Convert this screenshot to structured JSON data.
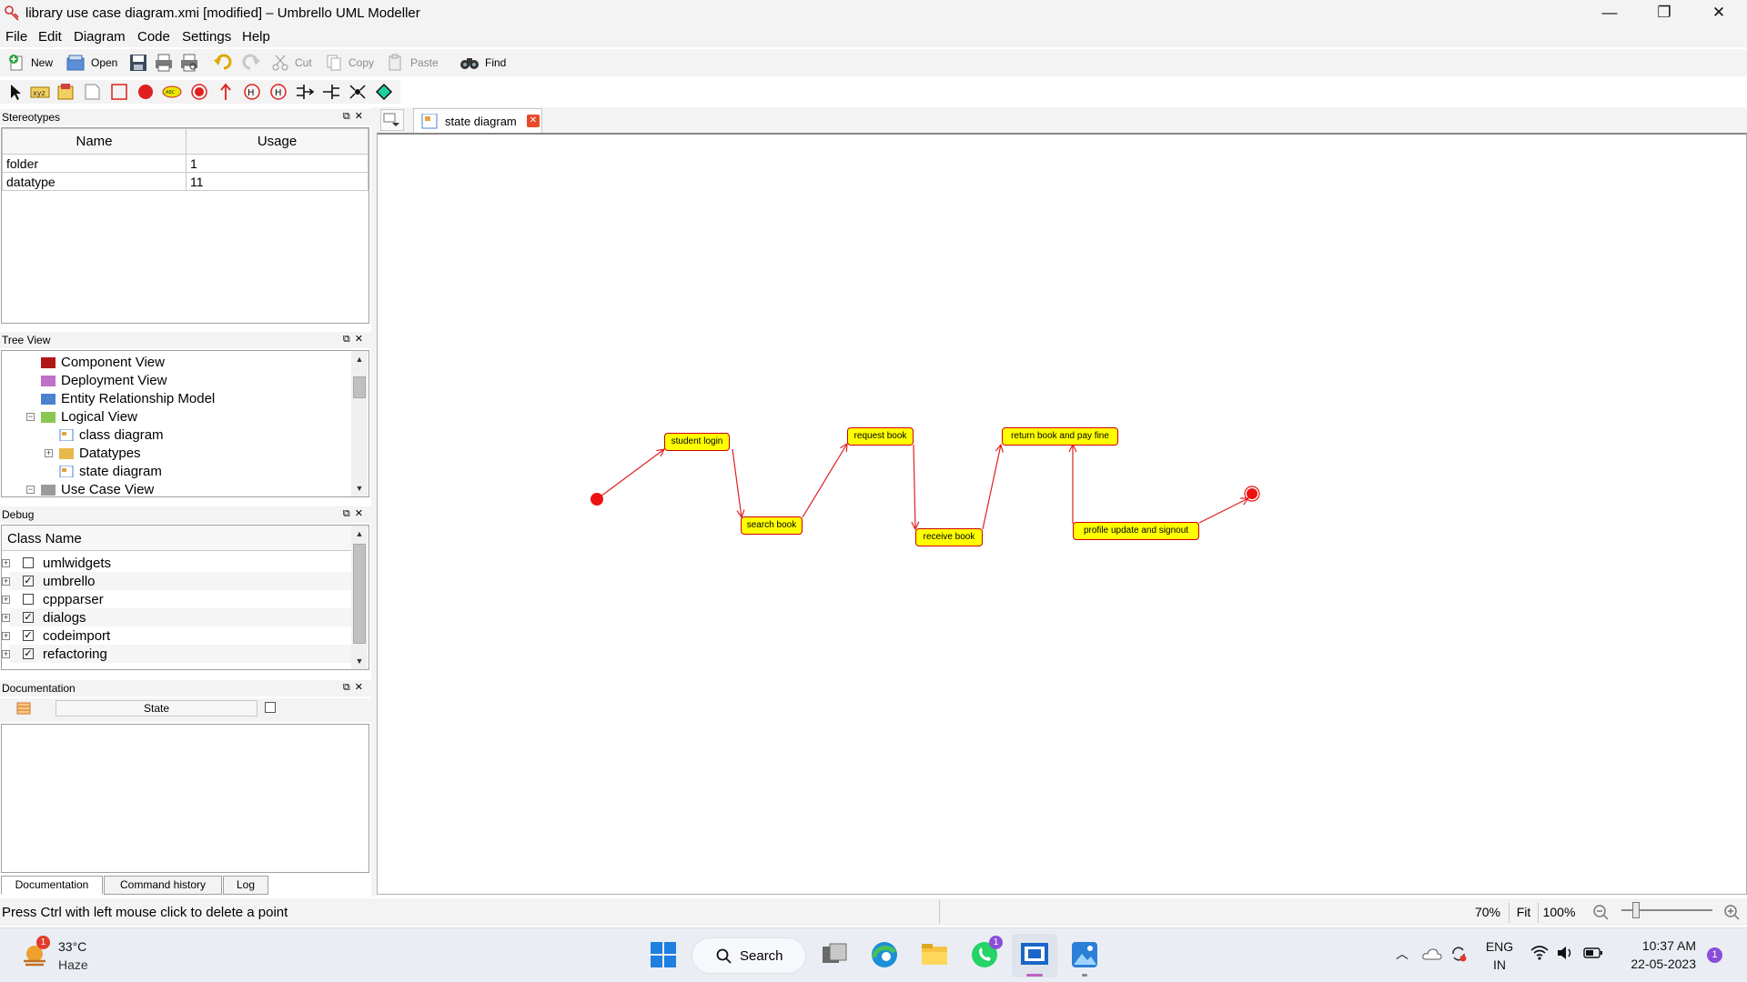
{
  "window": {
    "title": "library use case diagram.xmi [modified] – Umbrello UML Modeller",
    "minimize": "—",
    "restore": "❐",
    "close": "✕"
  },
  "menu": [
    "File",
    "Edit",
    "Diagram",
    "Code",
    "Settings",
    "Help"
  ],
  "toolbar": {
    "new": "New",
    "open": "Open",
    "cut": "Cut",
    "copy": "Copy",
    "paste": "Paste",
    "find": "Find"
  },
  "stereotypes": {
    "title": "Stereotypes",
    "columns": [
      "Name",
      "Usage"
    ],
    "rows": [
      {
        "name": "folder",
        "usage": "1"
      },
      {
        "name": "datatype",
        "usage": "11"
      }
    ]
  },
  "tree_view": {
    "title": "Tree View",
    "items": [
      {
        "label": "Component View",
        "icon": "component-folder-icon",
        "color": "#b01818"
      },
      {
        "label": "Deployment View",
        "icon": "deployment-folder-icon",
        "color": "#c070c8"
      },
      {
        "label": "Entity Relationship Model",
        "icon": "er-folder-icon",
        "color": "#4a82d0"
      },
      {
        "label": "Logical View",
        "icon": "logical-folder-icon",
        "color": "#8ac852"
      },
      {
        "label": "class diagram",
        "icon": "diagram-icon"
      },
      {
        "label": "Datatypes",
        "icon": "folder-icon",
        "color": "#e8b84a"
      },
      {
        "label": "state diagram",
        "icon": "diagram-icon"
      },
      {
        "label": "Use Case View",
        "icon": "usecase-folder-icon",
        "color": "#9a9a9a"
      }
    ]
  },
  "debug": {
    "title": "Debug",
    "column": "Class Name",
    "rows": [
      {
        "name": "umlwidgets",
        "checked": false
      },
      {
        "name": "umbrello",
        "checked": true
      },
      {
        "name": "cppparser",
        "checked": false
      },
      {
        "name": "dialogs",
        "checked": true
      },
      {
        "name": "codeimport",
        "checked": true
      },
      {
        "name": "refactoring",
        "checked": true
      }
    ]
  },
  "documentation": {
    "title": "Documentation",
    "state_label": "State",
    "tabs": [
      "Documentation",
      "Command history",
      "Log"
    ]
  },
  "diagram_tab": {
    "label": "state diagram"
  },
  "diagram": {
    "states": [
      {
        "id": "s1",
        "label": "student login"
      },
      {
        "id": "s2",
        "label": "search book"
      },
      {
        "id": "s3",
        "label": "request book"
      },
      {
        "id": "s4",
        "label": "receive book"
      },
      {
        "id": "s5",
        "label": "return book and pay fine"
      },
      {
        "id": "s6",
        "label": "profile update and signout"
      }
    ],
    "colors": {
      "state_fill": "#ffff00",
      "state_border": "#d00000",
      "transition": "#e02020",
      "pseudo": "#ee1111"
    }
  },
  "status": {
    "message": "Press Ctrl with left mouse click to delete a point",
    "zoom": "70%",
    "fit": "Fit",
    "full": "100%"
  },
  "taskbar": {
    "weather_temp": "33°C",
    "weather_desc": "Haze",
    "weather_badge": "1",
    "search": "Search",
    "whatsapp_badge": "1",
    "lang1": "ENG",
    "lang2": "IN",
    "time": "10:37 AM",
    "date": "22-05-2023",
    "notif_badge": "1"
  }
}
